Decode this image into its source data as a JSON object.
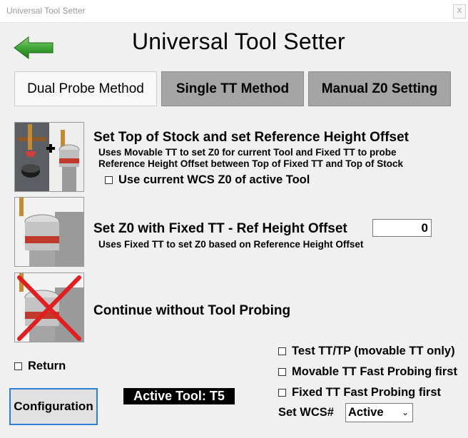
{
  "window": {
    "title": "Universal Tool Setter",
    "close_label": "X"
  },
  "header": {
    "title": "Universal Tool Setter",
    "back_icon": "green-left-arrow-icon"
  },
  "tabs": [
    {
      "label": "Dual Probe Method",
      "active": true
    },
    {
      "label": "Single TT Method",
      "active": false
    },
    {
      "label": "Manual Z0 Setting",
      "active": false
    }
  ],
  "options": {
    "top_of_stock": {
      "title": "Set Top of Stock and set Reference Height Offset",
      "desc_line1": "Uses Movable TT to set Z0 for current Tool and Fixed TT to probe",
      "desc_line2": "Reference Height Offset between Top of Fixed TT and Top of Stock",
      "checkbox_label": "Use current WCS Z0 of active Tool",
      "checked": false
    },
    "fixed_tt": {
      "title": "Set Z0 with Fixed TT - Ref Height Offset",
      "desc": "Uses Fixed TT to set Z0 based on Reference Height Offset",
      "offset_value": "0"
    },
    "no_probe": {
      "title": "Continue without Tool Probing"
    }
  },
  "checkboxes": {
    "return": "Return",
    "test_tt": "Test TT/TP (movable TT only)",
    "movable_fast": "Movable TT Fast Probing first",
    "fixed_fast": "Fixed TT Fast Probing first"
  },
  "buttons": {
    "configuration": "Configuration"
  },
  "status": {
    "active_tool": "Active Tool:  T5"
  },
  "wcs": {
    "label": "Set WCS#",
    "selected": "Active"
  },
  "colors": {
    "arrow": "#3fa535",
    "inactive_tab": "#a5a5a5",
    "focus_border": "#2f7fd6"
  }
}
